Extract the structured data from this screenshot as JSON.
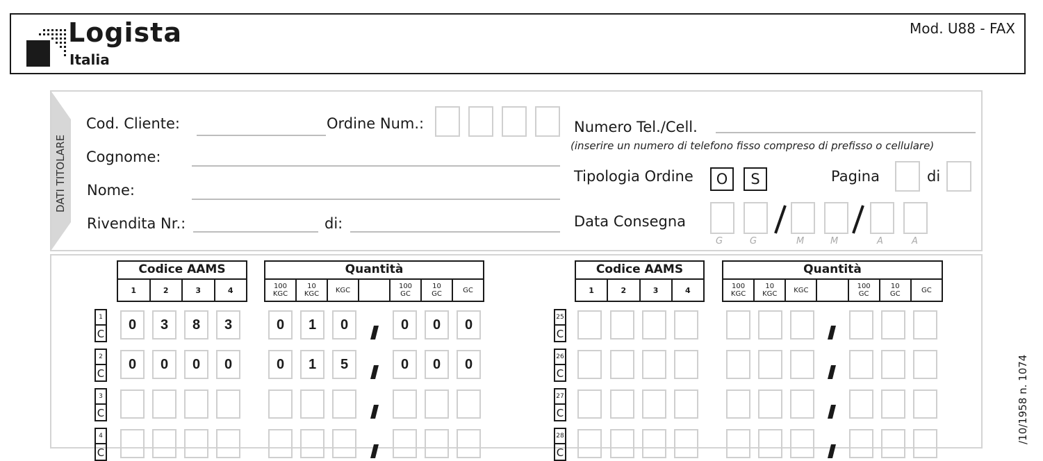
{
  "header": {
    "logo_word": "Logista",
    "logo_sub": "Italia",
    "model_code": "Mod. U88 - FAX"
  },
  "titolare": {
    "section_label": "DATI TITOLARE",
    "cod_cliente_label": "Cod. Cliente:",
    "ordine_num_label": "Ordine Num.:",
    "cognome_label": "Cognome:",
    "nome_label": "Nome:",
    "rivendita_label": "Rivendita Nr.:",
    "di_label": "di:",
    "telefono_label": "Numero Tel./Cell.",
    "telefono_note": "(inserire un numero di telefono fisso compreso di prefisso o cellulare)",
    "tipologia_label": "Tipologia Ordine",
    "tipologia_options": [
      "O",
      "S"
    ],
    "pagina_label": "Pagina",
    "pagina_di_label": "di",
    "data_consegna_label": "Data Consegna",
    "date_hints": [
      "G",
      "G",
      "M",
      "M",
      "A",
      "A"
    ]
  },
  "grid": {
    "codice_header": "Codice AAMS",
    "codice_cols": [
      "1",
      "2",
      "3",
      "4"
    ],
    "quantita_header": "Quantità",
    "quantita_cols": [
      [
        "100",
        "KGC"
      ],
      [
        "10",
        "KGC"
      ],
      [
        "KGC"
      ],
      [
        "100",
        "GC"
      ],
      [
        "10",
        "GC"
      ],
      [
        "GC"
      ]
    ],
    "left_rows": [
      {
        "num": "1",
        "tag": "C",
        "codice": [
          "0",
          "3",
          "8",
          "3"
        ],
        "qty": [
          "0",
          "1",
          "0",
          "0",
          "0",
          "0"
        ]
      },
      {
        "num": "2",
        "tag": "C",
        "codice": [
          "0",
          "0",
          "0",
          "0"
        ],
        "qty": [
          "0",
          "1",
          "5",
          "0",
          "0",
          "0"
        ]
      },
      {
        "num": "3",
        "tag": "C",
        "codice": [
          "",
          "",
          "",
          ""
        ],
        "qty": [
          "",
          "",
          "",
          "",
          "",
          ""
        ]
      },
      {
        "num": "4",
        "tag": "C",
        "codice": [
          "",
          "",
          "",
          ""
        ],
        "qty": [
          "",
          "",
          "",
          "",
          "",
          ""
        ]
      }
    ],
    "right_rows": [
      {
        "num": "25",
        "tag": "C",
        "codice": [
          "",
          "",
          "",
          ""
        ],
        "qty": [
          "",
          "",
          "",
          "",
          "",
          ""
        ]
      },
      {
        "num": "26",
        "tag": "C",
        "codice": [
          "",
          "",
          "",
          ""
        ],
        "qty": [
          "",
          "",
          "",
          "",
          "",
          ""
        ]
      },
      {
        "num": "27",
        "tag": "C",
        "codice": [
          "",
          "",
          "",
          ""
        ],
        "qty": [
          "",
          "",
          "",
          "",
          "",
          ""
        ]
      },
      {
        "num": "28",
        "tag": "C",
        "codice": [
          "",
          "",
          "",
          ""
        ],
        "qty": [
          "",
          "",
          "",
          "",
          "",
          ""
        ]
      }
    ]
  },
  "side_text": "/10/1958 n. 1074"
}
